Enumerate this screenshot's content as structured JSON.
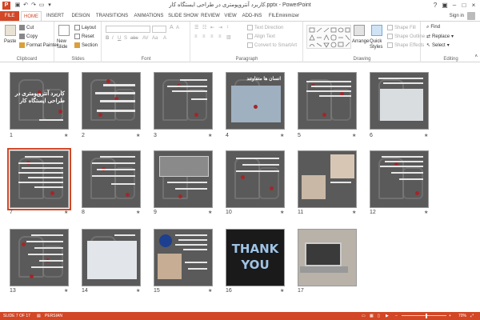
{
  "window": {
    "title": "کاربرد آنتروپومتری در طراحی ایستگاه کار.pptx - PowerPoint",
    "app_icon": "P",
    "sign_in": "Sign in"
  },
  "tabs": [
    "FILE",
    "HOME",
    "INSERT",
    "DESIGN",
    "TRANSITIONS",
    "ANIMATIONS",
    "SLIDE SHOW",
    "REVIEW",
    "VIEW",
    "ADD-INS",
    "FILEminimizer"
  ],
  "active_tab": "HOME",
  "ribbon": {
    "clipboard": {
      "label": "Clipboard",
      "paste": "Paste",
      "cut": "Cut",
      "copy": "Copy",
      "format_painter": "Format Painter"
    },
    "slides": {
      "label": "Slides",
      "new_slide": "New Slide",
      "layout": "Layout",
      "reset": "Reset",
      "section": "Section"
    },
    "font": {
      "label": "Font"
    },
    "paragraph": {
      "label": "Paragraph",
      "text_direction": "Text Direction",
      "align_text": "Align Text",
      "convert_smartart": "Convert to SmartArt"
    },
    "drawing": {
      "label": "Drawing",
      "arrange": "Arrange",
      "quick_styles": "Quick Styles",
      "shape_fill": "Shape Fill",
      "shape_outline": "Shape Outline",
      "shape_effects": "Shape Effects"
    },
    "editing": {
      "label": "Editing",
      "find": "Find",
      "replace": "Replace",
      "select": "Select"
    }
  },
  "slides": [
    {
      "n": "1",
      "text": "کاربرد آنتروپومتری در طراحی ایستگاه کار"
    },
    {
      "n": "2",
      "text": ""
    },
    {
      "n": "3",
      "text": ""
    },
    {
      "n": "4",
      "text": "انسان ها متفاوتند"
    },
    {
      "n": "5",
      "text": ""
    },
    {
      "n": "6",
      "text": ""
    },
    {
      "n": "7",
      "text": ""
    },
    {
      "n": "8",
      "text": ""
    },
    {
      "n": "9",
      "text": ""
    },
    {
      "n": "10",
      "text": ""
    },
    {
      "n": "11",
      "text": ""
    },
    {
      "n": "12",
      "text": ""
    },
    {
      "n": "13",
      "text": ""
    },
    {
      "n": "14",
      "text": ""
    },
    {
      "n": "15",
      "text": ""
    },
    {
      "n": "16",
      "text": "THANK YOU"
    },
    {
      "n": "17",
      "text": ""
    }
  ],
  "selected_slide": 7,
  "status": {
    "slide_info": "SLIDE 7 OF 17",
    "language": "PERSIAN",
    "zoom": "70%"
  },
  "colors": {
    "accent": "#d24726",
    "slide_bg": "#5a5a5a",
    "dot": "#a3262a"
  }
}
